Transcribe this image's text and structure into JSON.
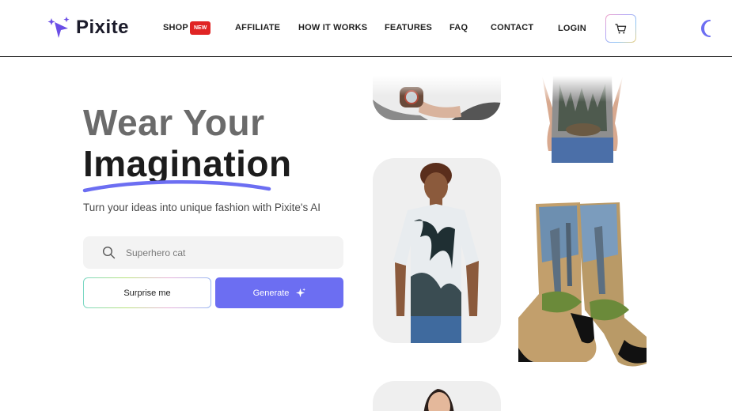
{
  "brand": {
    "name": "Pixite",
    "accent": "#6c6ef2",
    "logo_color": "#6b4ee6"
  },
  "nav": {
    "shop": "SHOP",
    "shop_badge": "NEW",
    "affiliate": "AFFILIATE",
    "how_it_works": "HOW IT WORKS",
    "features": "FEATURES",
    "faq": "FAQ",
    "contact": "CONTACT",
    "login": "LOGIN",
    "cart_icon": "cart-icon",
    "theme_icon": "moon-icon"
  },
  "hero": {
    "title_line1": "Wear Your",
    "title_line2": "Imagination",
    "subtitle": "Turn your ideas into unique fashion with Pixite's AI"
  },
  "search": {
    "placeholder": "Superhero cat",
    "value": ""
  },
  "buttons": {
    "surprise": "Surprise me",
    "generate": "Generate"
  },
  "products": [
    {
      "name": "watch",
      "icon": "watch-product-image"
    },
    {
      "name": "tank-top",
      "icon": "tank-top-product-image"
    },
    {
      "name": "tie-dye-tshirt",
      "icon": "tshirt-product-image"
    },
    {
      "name": "socks",
      "icon": "socks-product-image"
    },
    {
      "name": "woman-portrait",
      "icon": "woman-product-image"
    }
  ]
}
